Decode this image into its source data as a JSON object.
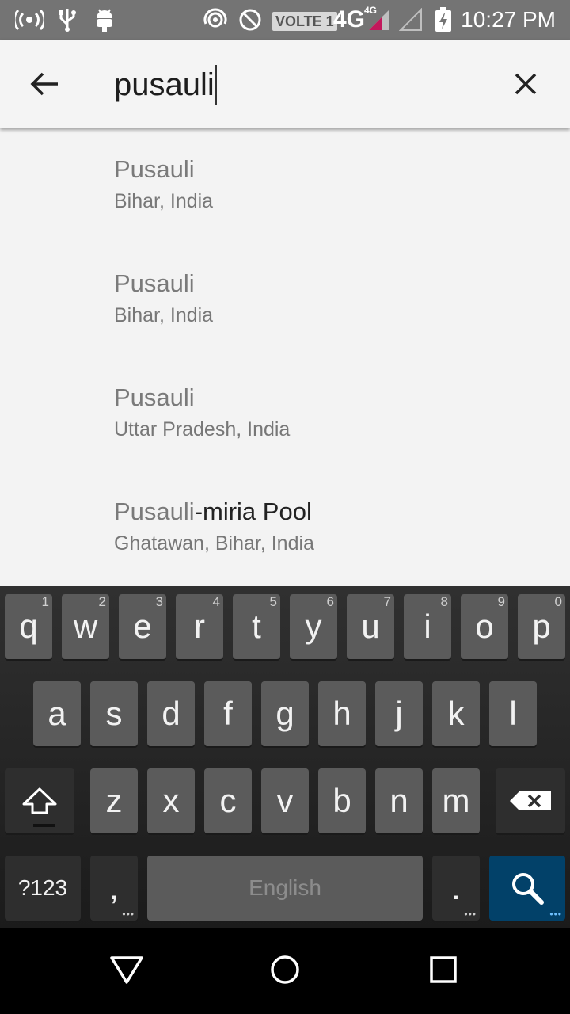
{
  "status_bar": {
    "time": "10:27 PM",
    "volte_label": "VOLTE 1",
    "network_label": "4G",
    "network_sup": "4G",
    "icons": [
      "hotspot-icon",
      "usb-icon",
      "android-debug-icon",
      "wifi-calling-icon",
      "do-not-disturb-icon",
      "signal-sim1-icon",
      "signal-sim2-icon",
      "battery-charging-icon"
    ]
  },
  "search": {
    "query": "pusauli",
    "back_icon": "arrow-back-icon",
    "clear_icon": "close-icon"
  },
  "results": [
    {
      "match": "Pusauli",
      "rest": "",
      "subtitle": "Bihar, India"
    },
    {
      "match": "Pusauli",
      "rest": "",
      "subtitle": "Bihar, India"
    },
    {
      "match": "Pusauli",
      "rest": "",
      "subtitle": "Uttar Pradesh, India"
    },
    {
      "match": "Pusauli",
      "rest": "-miria Pool",
      "subtitle": "Ghatawan, Bihar, India"
    }
  ],
  "keyboard": {
    "row1": [
      {
        "label": "q",
        "hint": "1"
      },
      {
        "label": "w",
        "hint": "2"
      },
      {
        "label": "e",
        "hint": "3"
      },
      {
        "label": "r",
        "hint": "4"
      },
      {
        "label": "t",
        "hint": "5"
      },
      {
        "label": "y",
        "hint": "6"
      },
      {
        "label": "u",
        "hint": "7"
      },
      {
        "label": "i",
        "hint": "8"
      },
      {
        "label": "o",
        "hint": "9"
      },
      {
        "label": "p",
        "hint": "0"
      }
    ],
    "row2": [
      "a",
      "s",
      "d",
      "f",
      "g",
      "h",
      "j",
      "k",
      "l"
    ],
    "row3": [
      "z",
      "x",
      "c",
      "v",
      "b",
      "n",
      "m"
    ],
    "symbols_label": "?123",
    "comma_label": ",",
    "space_label": "English",
    "period_label": ".",
    "colors": {
      "key": "#5b5b5b",
      "special_key": "#2e2e2e",
      "action_key": "#024169"
    }
  },
  "navigation": {
    "icons": [
      "back-triangle-icon",
      "home-circle-icon",
      "recents-square-icon"
    ]
  }
}
